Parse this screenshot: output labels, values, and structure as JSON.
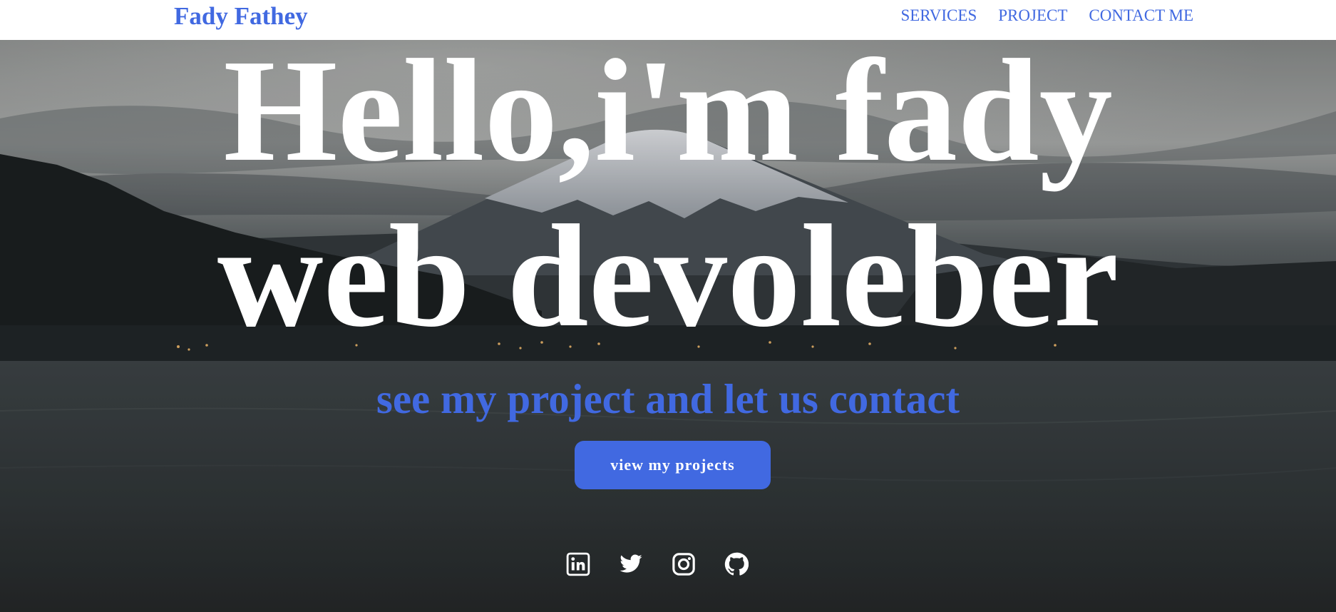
{
  "navbar": {
    "brand": "Fady Fathey",
    "links": [
      {
        "label": "SERVICES"
      },
      {
        "label": "PROJECT"
      },
      {
        "label": "CONTACT ME"
      }
    ]
  },
  "hero": {
    "headline_line1": "Hello,i'm fady",
    "headline_line2": "web devoleber",
    "subline": "see my project and let us contact",
    "cta_label": "view my projects",
    "background": "mountain-lake-dusk-photo",
    "socials": [
      {
        "icon": "linkedin-icon"
      },
      {
        "icon": "twitter-icon"
      },
      {
        "icon": "instagram-icon"
      },
      {
        "icon": "github-icon"
      }
    ]
  },
  "colors": {
    "accent": "#4169e1",
    "nav_background": "#ffffff",
    "headline": "#ffffff"
  }
}
